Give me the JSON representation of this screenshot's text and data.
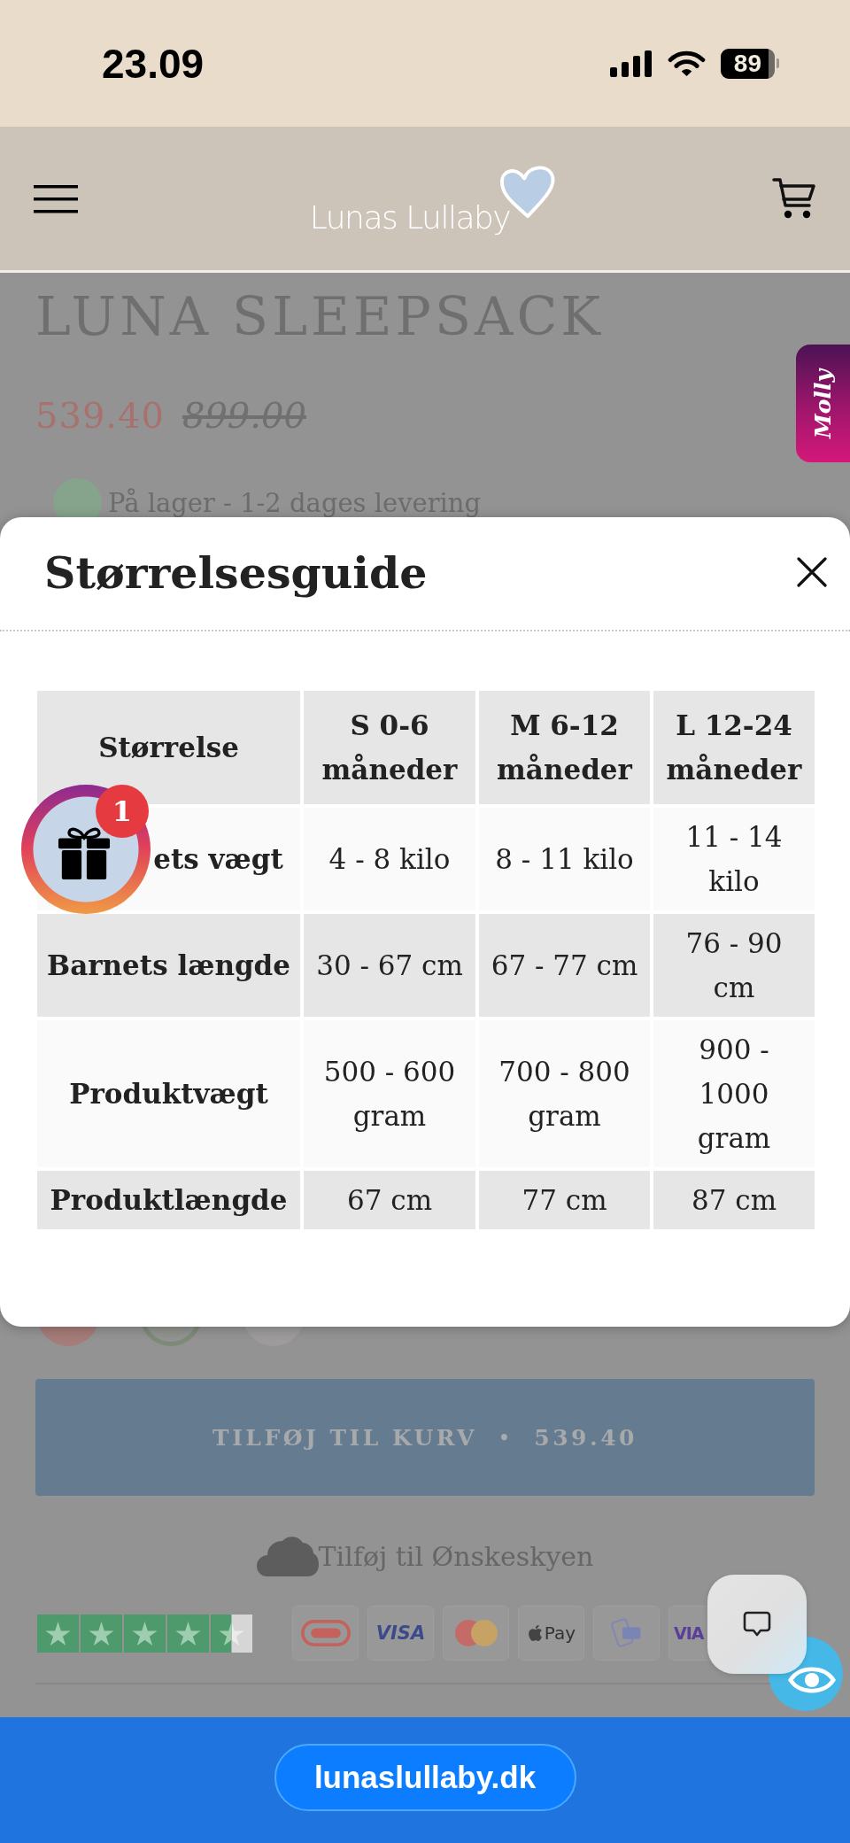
{
  "status_bar": {
    "time": "23.09",
    "battery": "89"
  },
  "header": {
    "logo": "Lunas Lullaby"
  },
  "product": {
    "title": "LUNA SLEEPSACK",
    "price": "539.40",
    "old_price": "899.00",
    "stock": "På lager - 1-2 dages levering",
    "swatches": [
      {
        "color": "#a47c79",
        "selected": false
      },
      {
        "color": "#8f948c",
        "selected": true
      },
      {
        "color": "#9d9b9b",
        "selected": false
      }
    ],
    "add_to_cart": {
      "label": "TILFØJ TIL KURV",
      "separator": "•",
      "price": "539.40"
    },
    "wishlist": "Tilføj til Ønskeskyen",
    "trustpilot": {
      "stars": 4.5
    },
    "payment_methods": [
      {
        "kind": "dankort"
      },
      {
        "kind": "visa",
        "label": "VISA"
      },
      {
        "kind": "mastercard"
      },
      {
        "kind": "applepay",
        "label": "Pay"
      },
      {
        "kind": "mobilepay"
      },
      {
        "kind": "viabill",
        "label": "VIA"
      }
    ]
  },
  "molly_tab": {
    "label": "Molly"
  },
  "size_guide": {
    "title": "Størrelsesguide",
    "table": {
      "columns": [
        "Størrelse",
        "S 0-6 måneder",
        "M 6-12 måneder",
        "L 12-24 måneder"
      ],
      "rows": [
        [
          "ets vægt",
          "4 - 8 kilo",
          "8 - 11 kilo",
          "11 - 14 kilo"
        ],
        [
          "Barnets længde",
          "30 - 67 cm",
          "67 - 77 cm",
          "76 - 90 cm"
        ],
        [
          "Produktvægt",
          "500 - 600 gram",
          "700 - 800 gram",
          "900 - 1000 gram"
        ],
        [
          "Produktlængde",
          "67 cm",
          "77 cm",
          "87 cm"
        ]
      ]
    }
  },
  "gift_widget": {
    "badge": "1"
  },
  "browser_bar": {
    "url": "lunaslullaby.dk"
  }
}
